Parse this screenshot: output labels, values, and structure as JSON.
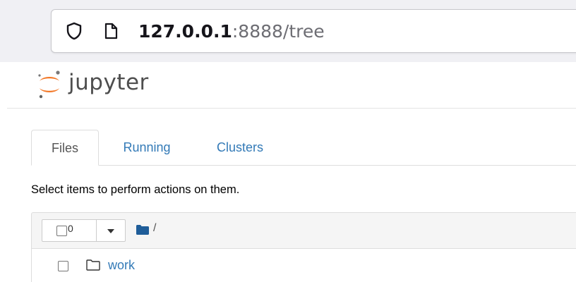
{
  "browser": {
    "url_host": "127.0.0.1",
    "url_rest": ":8888/tree"
  },
  "header": {
    "logo_text": "jupyter"
  },
  "tabs": [
    {
      "label": "Files",
      "active": true
    },
    {
      "label": "Running",
      "active": false
    },
    {
      "label": "Clusters",
      "active": false
    }
  ],
  "hint": "Select items to perform actions on them.",
  "toolbar": {
    "selected_count": "0",
    "path_separator": "/"
  },
  "files": [
    {
      "name": "work",
      "type": "folder"
    }
  ],
  "colors": {
    "link": "#337ab7",
    "jupyter_orange": "#f37726"
  }
}
